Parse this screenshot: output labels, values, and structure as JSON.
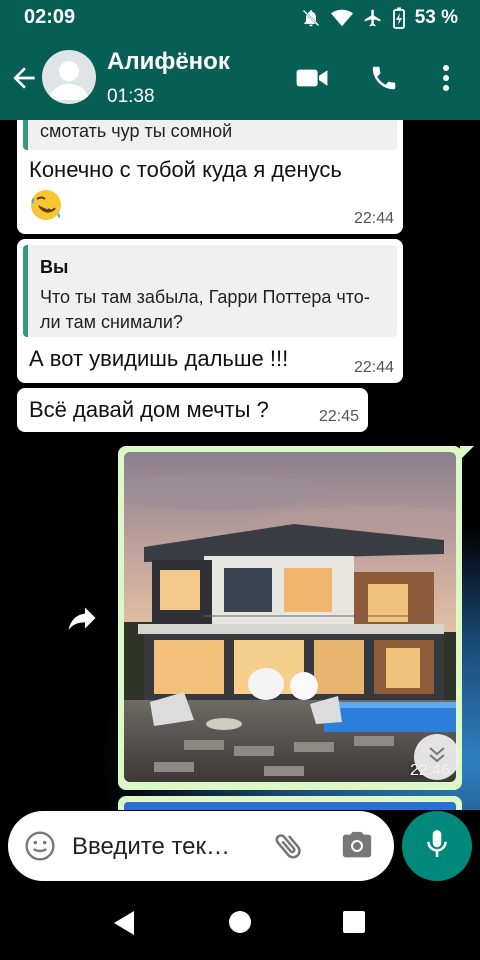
{
  "status_bar": {
    "time": "02:09",
    "battery": "53 %",
    "icons": [
      "notifications-off-icon",
      "wifi-icon",
      "airplane-icon",
      "battery-charging-icon"
    ]
  },
  "header": {
    "contact_name": "Алифёнок",
    "contact_status": "01:38",
    "icons": [
      "back-arrow-icon",
      "avatar",
      "video-call-icon",
      "phone-icon",
      "more-vert-icon"
    ]
  },
  "messages": [
    {
      "quote_text": "смотать чур ты сомной",
      "text": "Конечно с тобой куда я денусь",
      "emoji": "rolling-laughing-emoji",
      "time": "22:44"
    },
    {
      "quote_author": "Вы",
      "quote_text": "Что ты там забыла, Гарри Поттера что-ли там снимали?",
      "text": "А вот увидишь дальше !!!",
      "time": "22:44"
    },
    {
      "text": "Всё давай дом мечты ?",
      "time": "22:45"
    },
    {
      "type": "image",
      "image": "modern-house-photo",
      "time": "22:46"
    }
  ],
  "composer": {
    "placeholder": "Введите тек…",
    "icons": [
      "emoji-icon",
      "attach-icon",
      "camera-icon",
      "mic-icon"
    ]
  },
  "colors": {
    "header_bg": "#075e54",
    "outgoing_bubble": "#dcf8c6",
    "incoming_bubble": "#ffffff",
    "quote_bar": "#35987f",
    "mic_button": "#00897b"
  }
}
